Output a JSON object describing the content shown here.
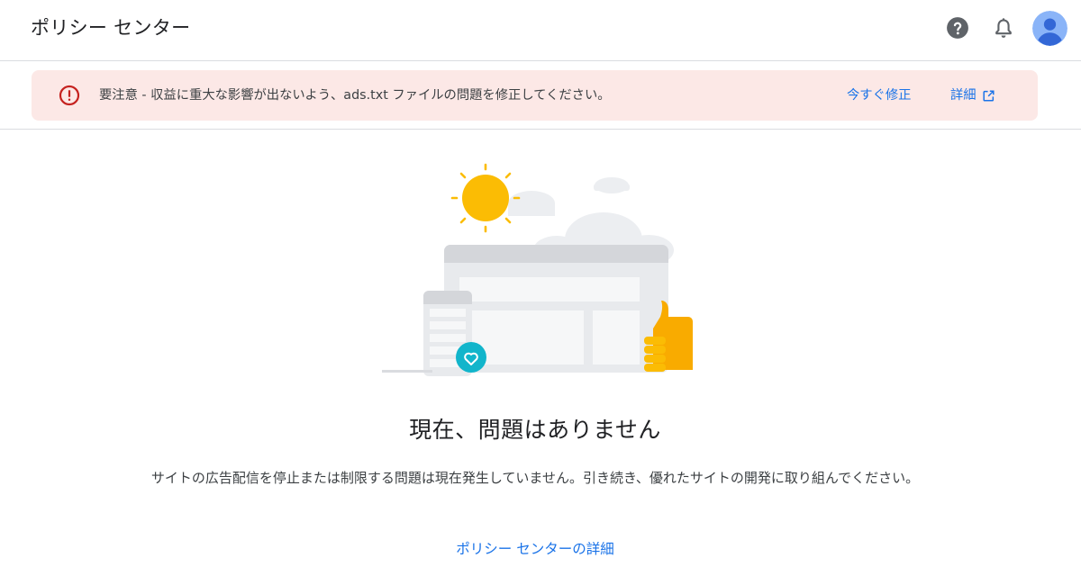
{
  "header": {
    "title": "ポリシー センター",
    "help_icon": "help-circle-icon",
    "notifications_icon": "bell-icon",
    "avatar_icon": "account-avatar-icon"
  },
  "alert": {
    "icon": "error-icon",
    "message": "要注意 - 収益に重大な影響が出ないよう、ads.txt ファイルの問題を修正してください。",
    "fix_label": "今すぐ修正",
    "details_label": "詳細",
    "details_icon": "open-in-new-icon",
    "background_color": "#fce8e6",
    "icon_color": "#c5221f"
  },
  "main": {
    "illustration": "sun-clouds-browser-phone-thumbs-up",
    "headline": "現在、問題はありません",
    "description": "サイトの広告配信を停止または制限する問題は現在発生していません。引き続き、優れたサイトの開発に取り組んでください。",
    "learn_more_label": "ポリシー センターの詳細"
  },
  "colors": {
    "link": "#1a73e8",
    "sun": "#fbbc04",
    "thumb": "#f9ab00",
    "heart_badge": "#12b5cb",
    "avatar": "#8ab4f8"
  }
}
